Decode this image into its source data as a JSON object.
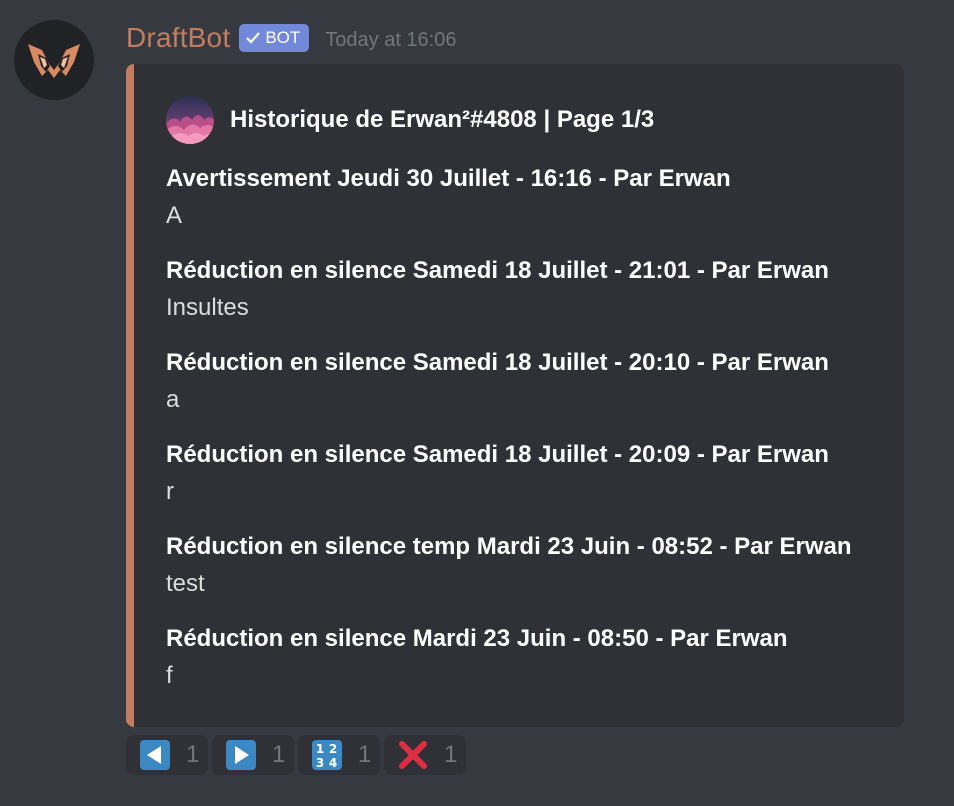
{
  "message": {
    "author": "DraftBot",
    "bot_tag": "BOT",
    "timestamp": "Today at 16:06",
    "accent_color": "#c27c5e",
    "avatar_icon": "draftbot-logo-icon"
  },
  "embed": {
    "author": "Historique de Erwan²#4808 | Page 1/3",
    "author_icon": "purple-gradient-avatar-icon",
    "fields": [
      {
        "name": "Avertissement Jeudi 30 Juillet - 16:16 - Par Erwan",
        "value": "A"
      },
      {
        "name": "Réduction en silence Samedi 18 Juillet - 21:01 - Par Erwan",
        "value": "Insultes"
      },
      {
        "name": "Réduction en silence Samedi 18 Juillet - 20:10 - Par Erwan",
        "value": "a"
      },
      {
        "name": "Réduction en silence Samedi 18 Juillet - 20:09 - Par Erwan",
        "value": "r"
      },
      {
        "name": "Réduction en silence temp Mardi 23 Juin - 08:52 - Par Erwan",
        "value": "test"
      },
      {
        "name": "Réduction en silence Mardi 23 Juin - 08:50 - Par Erwan",
        "value": "f"
      }
    ]
  },
  "reactions": [
    {
      "emoji": "arrow-backward-icon",
      "count": "1"
    },
    {
      "emoji": "arrow-forward-icon",
      "count": "1"
    },
    {
      "emoji": "numbers-1234-icon",
      "count": "1"
    },
    {
      "emoji": "red-x-icon",
      "count": "1"
    }
  ]
}
